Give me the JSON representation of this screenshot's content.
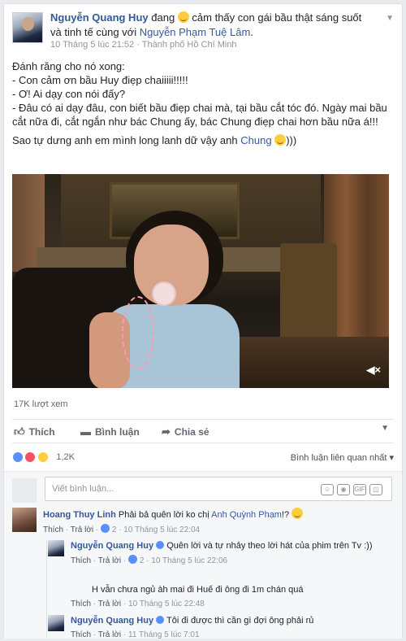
{
  "post": {
    "author": "Nguyễn Quang Huy",
    "feeling_prefix": "đang",
    "feeling": "cảm thấy con gái bầu thật sáng suốt và tinh tế cùng với",
    "tagged": "Nguyễn Phạm Tuệ Lâm",
    "tagged_suffix": ".",
    "timestamp": "10 Tháng 5 lúc 21:52",
    "location": "Thành phố Hồ Chí Minh",
    "text_lines": [
      "Đánh răng cho nó xong:",
      "- Con cảm ơn bầu Huy điẹp chaiiiii!!!!!",
      "- Ơ! Ai dạy con nói đấy?",
      "- Đâu có ai dạy đâu, con biết bầu điẹp chai mà, tại bầu cắt tóc đó. Ngày mai bầu cắt nữa đi, cắt ngắn như bác Chung ấy, bác Chung điẹp chai hơn bầu nữa á!!!"
    ],
    "closing_prefix": "Sao tự dưng anh em mình long lanh dữ vậy anh",
    "closing_link": "Chung",
    "closing_suffix": ")))",
    "views": "17K lượt xem"
  },
  "actions": {
    "like": "Thích",
    "comment": "Bình luận",
    "share": "Chia sẻ"
  },
  "reactions": {
    "count": "1,2K",
    "sort_label": "Bình luận liên quan nhất"
  },
  "comment_input": {
    "placeholder": "Viết bình luận..."
  },
  "comments": [
    {
      "author": "Hoang Thuy Linh",
      "text": "Phải bả quên lời ko chị",
      "mention": "Anh Quỳnh Phạm",
      "text_suffix": "!?",
      "like": "Thích",
      "reply": "Trả lời",
      "replies": "2",
      "time": "10 Tháng 5 lúc 22:04"
    },
    {
      "author": "Nguyễn Quang Huy",
      "text": "Quên lời và tự nhảy theo lời hát của phim trên Tv :))",
      "like": "Thích",
      "reply": "Trả lời",
      "replies": "2",
      "time": "10 Tháng 5 lúc 22:06"
    },
    {
      "text": "H vẫn chưa ngủ àh mai đi Huế đi ông đi 1m chán quá",
      "like": "Thích",
      "reply": "Trả lời",
      "time": "10 Tháng 5 lúc 22:48"
    },
    {
      "author": "Nguyễn Quang Huy",
      "text": "Tôi đi được thì cần gì đợi ông phải rủ",
      "like": "Thích",
      "reply": "Trả lời",
      "time": "11 Tháng 5 lúc 7:01"
    }
  ]
}
